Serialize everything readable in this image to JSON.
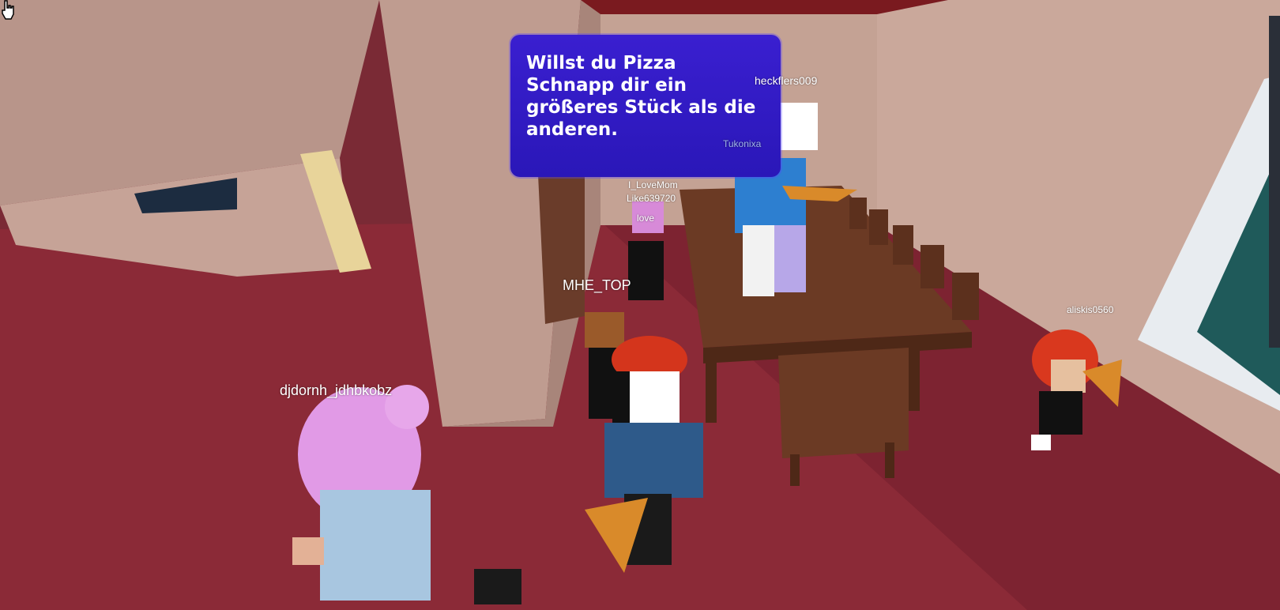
{
  "tooltip": {
    "text": "Willst du Pizza\nSchnapp dir ein\ngrößeres Stück als die\nanderen."
  },
  "players": [
    {
      "id": "heckflers",
      "name": "heckflers009"
    },
    {
      "id": "tukonixa",
      "name": "Tukonixa"
    },
    {
      "id": "ilovemom",
      "name": "I_LoveMom"
    },
    {
      "id": "like",
      "name": "Like639720"
    },
    {
      "id": "love",
      "name": "love"
    },
    {
      "id": "mhetop",
      "name": "MHE_TOP"
    },
    {
      "id": "djdornh",
      "name": "djdornh_jdhbkobz"
    },
    {
      "id": "aliskis",
      "name": "aliskis0560"
    }
  ],
  "colors": {
    "floor": "#8b2a37",
    "wall": "#c9a79a",
    "ceiling": "#7a1a1f",
    "tooltip_bg": "#3a1fd0"
  },
  "icons": {
    "cursor": "hand-pointer-icon"
  }
}
